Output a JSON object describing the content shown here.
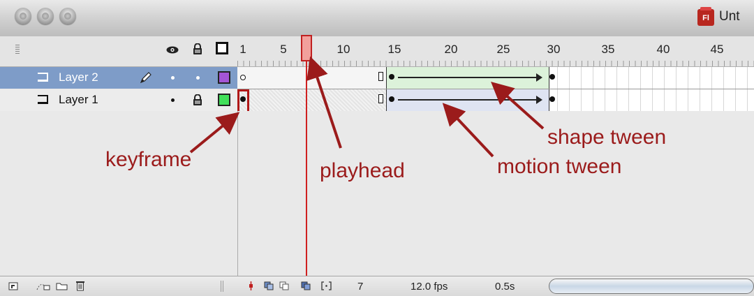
{
  "window": {
    "title": "Unt",
    "app_badge": "Fl"
  },
  "ruler": {
    "frame_numbers": [
      "1",
      "5",
      "10",
      "15",
      "20",
      "25",
      "30",
      "35",
      "40",
      "45"
    ]
  },
  "layers": [
    {
      "name": "Layer 2",
      "selected": true,
      "color": "#a455d6"
    },
    {
      "name": "Layer 1",
      "selected": false,
      "color": "#41e05a"
    }
  ],
  "bottom_bar": {
    "current_frame": "7",
    "frame_rate": "12.0 fps",
    "elapsed_time": "0.5s"
  },
  "annotations": {
    "keyframe": "keyframe",
    "playhead": "playhead",
    "motion_tween": "motion tween",
    "shape_tween": "shape tween"
  },
  "colors": {
    "annotation": "#9b1b1b",
    "playhead": "#d02020",
    "selected_layer": "#7e9cc8",
    "shape_tween_fill": "#dcf2da",
    "motion_tween_fill": "#dfe4f2"
  },
  "icons": [
    "eye-icon",
    "lock-icon",
    "outline-icon",
    "pencil-icon",
    "new-layer-icon",
    "motion-guide-icon",
    "folder-icon",
    "trash-icon",
    "center-frame-icon",
    "onion-skin-icon",
    "onion-outline-icon",
    "edit-multiple-icon",
    "modify-markers-icon"
  ]
}
